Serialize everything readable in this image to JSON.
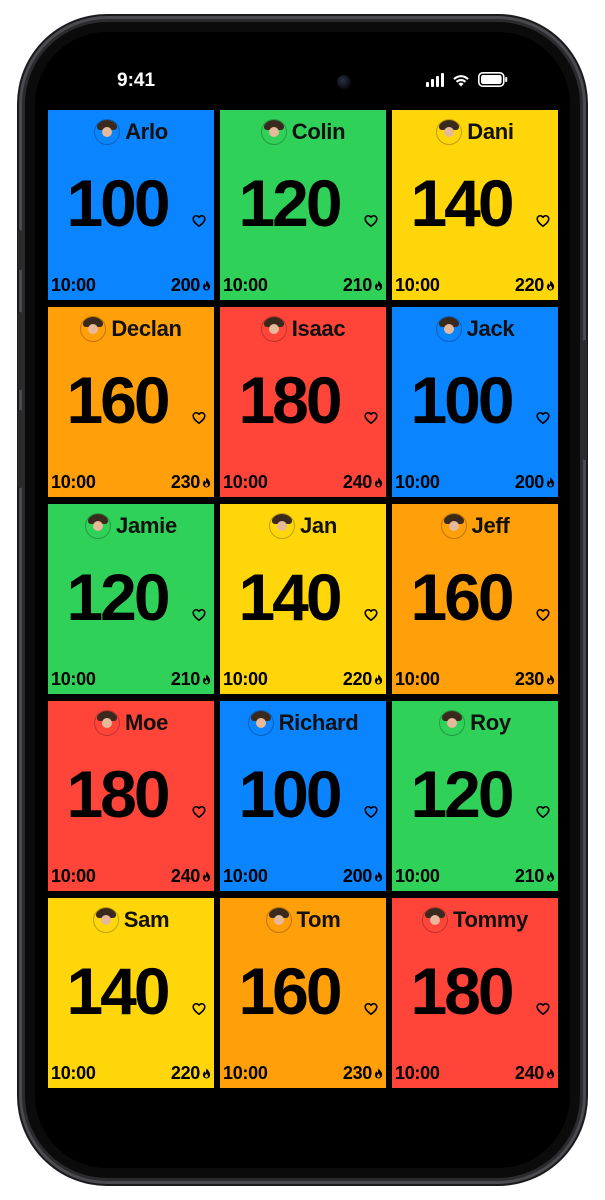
{
  "status_bar": {
    "time": "9:41"
  },
  "colors": {
    "blue": "#0a84ff",
    "green": "#30d158",
    "yellow": "#ffd60a",
    "orange": "#ff9f0a",
    "red": "#ff453a",
    "frame": "#0b0b0c"
  },
  "icons": {
    "heart": "heart-outline-icon",
    "flame": "flame-icon",
    "signal": "cellular-signal-icon",
    "wifi": "wifi-icon",
    "battery": "battery-icon"
  },
  "tiles": [
    {
      "name": "Arlo",
      "bpm": "100",
      "elapsed": "10:00",
      "max": "200",
      "color": "#0a84ff"
    },
    {
      "name": "Colin",
      "bpm": "120",
      "elapsed": "10:00",
      "max": "210",
      "color": "#30d158"
    },
    {
      "name": "Dani",
      "bpm": "140",
      "elapsed": "10:00",
      "max": "220",
      "color": "#ffd60a"
    },
    {
      "name": "Declan",
      "bpm": "160",
      "elapsed": "10:00",
      "max": "230",
      "color": "#ff9f0a"
    },
    {
      "name": "Isaac",
      "bpm": "180",
      "elapsed": "10:00",
      "max": "240",
      "color": "#ff453a"
    },
    {
      "name": "Jack",
      "bpm": "100",
      "elapsed": "10:00",
      "max": "200",
      "color": "#0a84ff"
    },
    {
      "name": "Jamie",
      "bpm": "120",
      "elapsed": "10:00",
      "max": "210",
      "color": "#30d158"
    },
    {
      "name": "Jan",
      "bpm": "140",
      "elapsed": "10:00",
      "max": "220",
      "color": "#ffd60a"
    },
    {
      "name": "Jeff",
      "bpm": "160",
      "elapsed": "10:00",
      "max": "230",
      "color": "#ff9f0a"
    },
    {
      "name": "Moe",
      "bpm": "180",
      "elapsed": "10:00",
      "max": "240",
      "color": "#ff453a"
    },
    {
      "name": "Richard",
      "bpm": "100",
      "elapsed": "10:00",
      "max": "200",
      "color": "#0a84ff"
    },
    {
      "name": "Roy",
      "bpm": "120",
      "elapsed": "10:00",
      "max": "210",
      "color": "#30d158"
    },
    {
      "name": "Sam",
      "bpm": "140",
      "elapsed": "10:00",
      "max": "220",
      "color": "#ffd60a"
    },
    {
      "name": "Tom",
      "bpm": "160",
      "elapsed": "10:00",
      "max": "230",
      "color": "#ff9f0a"
    },
    {
      "name": "Tommy",
      "bpm": "180",
      "elapsed": "10:00",
      "max": "240",
      "color": "#ff453a"
    }
  ]
}
